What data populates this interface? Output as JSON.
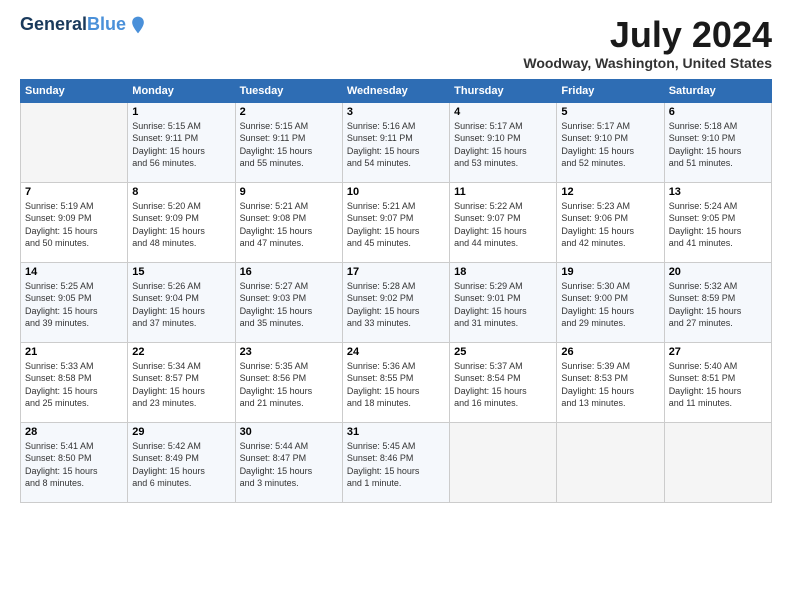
{
  "header": {
    "logo_line1": "General",
    "logo_line2": "Blue",
    "month_year": "July 2024",
    "location": "Woodway, Washington, United States"
  },
  "weekdays": [
    "Sunday",
    "Monday",
    "Tuesday",
    "Wednesday",
    "Thursday",
    "Friday",
    "Saturday"
  ],
  "weeks": [
    [
      {
        "day": "",
        "info": ""
      },
      {
        "day": "1",
        "info": "Sunrise: 5:15 AM\nSunset: 9:11 PM\nDaylight: 15 hours\nand 56 minutes."
      },
      {
        "day": "2",
        "info": "Sunrise: 5:15 AM\nSunset: 9:11 PM\nDaylight: 15 hours\nand 55 minutes."
      },
      {
        "day": "3",
        "info": "Sunrise: 5:16 AM\nSunset: 9:11 PM\nDaylight: 15 hours\nand 54 minutes."
      },
      {
        "day": "4",
        "info": "Sunrise: 5:17 AM\nSunset: 9:10 PM\nDaylight: 15 hours\nand 53 minutes."
      },
      {
        "day": "5",
        "info": "Sunrise: 5:17 AM\nSunset: 9:10 PM\nDaylight: 15 hours\nand 52 minutes."
      },
      {
        "day": "6",
        "info": "Sunrise: 5:18 AM\nSunset: 9:10 PM\nDaylight: 15 hours\nand 51 minutes."
      }
    ],
    [
      {
        "day": "7",
        "info": "Sunrise: 5:19 AM\nSunset: 9:09 PM\nDaylight: 15 hours\nand 50 minutes."
      },
      {
        "day": "8",
        "info": "Sunrise: 5:20 AM\nSunset: 9:09 PM\nDaylight: 15 hours\nand 48 minutes."
      },
      {
        "day": "9",
        "info": "Sunrise: 5:21 AM\nSunset: 9:08 PM\nDaylight: 15 hours\nand 47 minutes."
      },
      {
        "day": "10",
        "info": "Sunrise: 5:21 AM\nSunset: 9:07 PM\nDaylight: 15 hours\nand 45 minutes."
      },
      {
        "day": "11",
        "info": "Sunrise: 5:22 AM\nSunset: 9:07 PM\nDaylight: 15 hours\nand 44 minutes."
      },
      {
        "day": "12",
        "info": "Sunrise: 5:23 AM\nSunset: 9:06 PM\nDaylight: 15 hours\nand 42 minutes."
      },
      {
        "day": "13",
        "info": "Sunrise: 5:24 AM\nSunset: 9:05 PM\nDaylight: 15 hours\nand 41 minutes."
      }
    ],
    [
      {
        "day": "14",
        "info": "Sunrise: 5:25 AM\nSunset: 9:05 PM\nDaylight: 15 hours\nand 39 minutes."
      },
      {
        "day": "15",
        "info": "Sunrise: 5:26 AM\nSunset: 9:04 PM\nDaylight: 15 hours\nand 37 minutes."
      },
      {
        "day": "16",
        "info": "Sunrise: 5:27 AM\nSunset: 9:03 PM\nDaylight: 15 hours\nand 35 minutes."
      },
      {
        "day": "17",
        "info": "Sunrise: 5:28 AM\nSunset: 9:02 PM\nDaylight: 15 hours\nand 33 minutes."
      },
      {
        "day": "18",
        "info": "Sunrise: 5:29 AM\nSunset: 9:01 PM\nDaylight: 15 hours\nand 31 minutes."
      },
      {
        "day": "19",
        "info": "Sunrise: 5:30 AM\nSunset: 9:00 PM\nDaylight: 15 hours\nand 29 minutes."
      },
      {
        "day": "20",
        "info": "Sunrise: 5:32 AM\nSunset: 8:59 PM\nDaylight: 15 hours\nand 27 minutes."
      }
    ],
    [
      {
        "day": "21",
        "info": "Sunrise: 5:33 AM\nSunset: 8:58 PM\nDaylight: 15 hours\nand 25 minutes."
      },
      {
        "day": "22",
        "info": "Sunrise: 5:34 AM\nSunset: 8:57 PM\nDaylight: 15 hours\nand 23 minutes."
      },
      {
        "day": "23",
        "info": "Sunrise: 5:35 AM\nSunset: 8:56 PM\nDaylight: 15 hours\nand 21 minutes."
      },
      {
        "day": "24",
        "info": "Sunrise: 5:36 AM\nSunset: 8:55 PM\nDaylight: 15 hours\nand 18 minutes."
      },
      {
        "day": "25",
        "info": "Sunrise: 5:37 AM\nSunset: 8:54 PM\nDaylight: 15 hours\nand 16 minutes."
      },
      {
        "day": "26",
        "info": "Sunrise: 5:39 AM\nSunset: 8:53 PM\nDaylight: 15 hours\nand 13 minutes."
      },
      {
        "day": "27",
        "info": "Sunrise: 5:40 AM\nSunset: 8:51 PM\nDaylight: 15 hours\nand 11 minutes."
      }
    ],
    [
      {
        "day": "28",
        "info": "Sunrise: 5:41 AM\nSunset: 8:50 PM\nDaylight: 15 hours\nand 8 minutes."
      },
      {
        "day": "29",
        "info": "Sunrise: 5:42 AM\nSunset: 8:49 PM\nDaylight: 15 hours\nand 6 minutes."
      },
      {
        "day": "30",
        "info": "Sunrise: 5:44 AM\nSunset: 8:47 PM\nDaylight: 15 hours\nand 3 minutes."
      },
      {
        "day": "31",
        "info": "Sunrise: 5:45 AM\nSunset: 8:46 PM\nDaylight: 15 hours\nand 1 minute."
      },
      {
        "day": "",
        "info": ""
      },
      {
        "day": "",
        "info": ""
      },
      {
        "day": "",
        "info": ""
      }
    ]
  ]
}
